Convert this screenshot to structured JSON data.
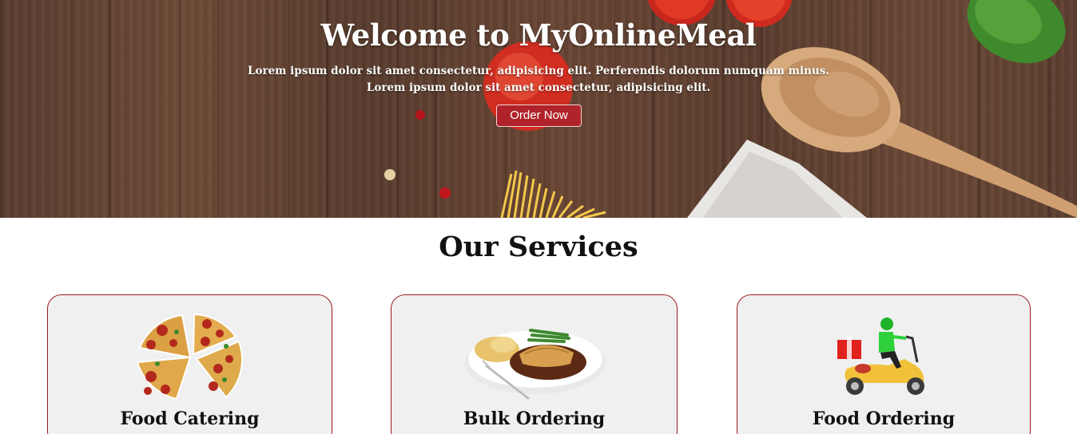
{
  "hero": {
    "title": "Welcome to MyOnlineMeal",
    "subtitle_line1": "Lorem ipsum dolor sit amet consectetur, adipisicing elit. Perferendis dolorum numquam minus.",
    "subtitle_line2": "Lorem ipsum dolor sit amet consectetur, adipisicing elit.",
    "order_button": "Order Now"
  },
  "services": {
    "title": "Our Services",
    "cards": [
      {
        "title": "Food Catering",
        "icon": "pizza-icon"
      },
      {
        "title": "Bulk Ordering",
        "icon": "meal-plate-icon"
      },
      {
        "title": "Food Ordering",
        "icon": "delivery-scooter-icon"
      }
    ]
  },
  "colors": {
    "accent": "#b0232a",
    "card_border": "#9b1c1f",
    "card_bg": "#f0f0f0"
  }
}
